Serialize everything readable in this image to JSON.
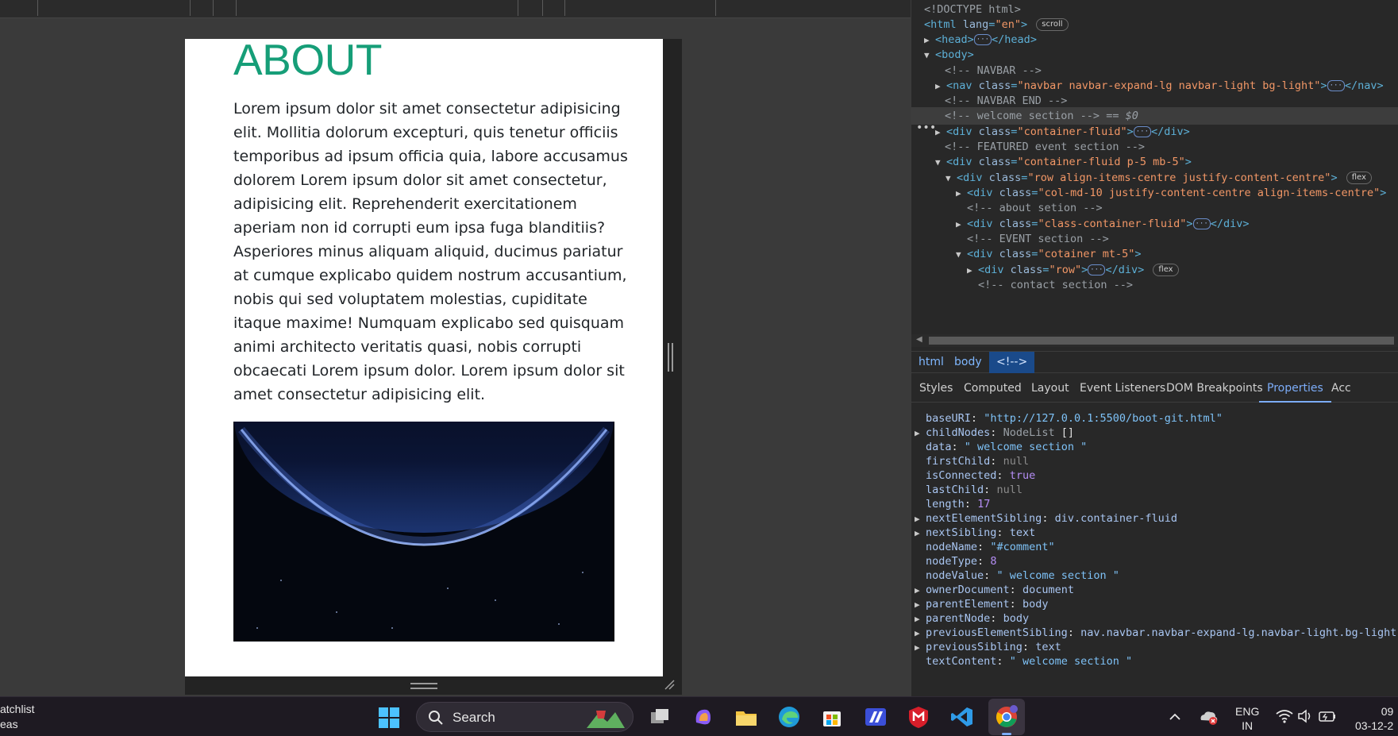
{
  "viewport": {
    "about_heading": "ABOUT",
    "about_paragraph": "Lorem ipsum dolor sit amet consectetur adipisicing elit. Mollitia dolorum excepturi, quis tenetur officiis temporibus ad ipsum officia quia, labore accusamus dolorem Lorem ipsum dolor sit amet consectetur, adipisicing elit. Reprehenderit exercitationem aperiam non id corrupti eum ipsa fuga blanditiis? Asperiores minus aliquam aliquid, ducimus pariatur at cumque explicabo quidem nostrum accusantium, nobis qui sed voluptatem molestias, cupiditate itaque maxime! Numquam explicabo sed quisquam animi architecto veritatis quasi, nobis corrupti obcaecati Lorem ipsum dolor. Lorem ipsum dolor sit amet consectetur adipisicing elit.",
    "image_icon": "earth-from-space-image"
  },
  "devtools": {
    "dom": {
      "doctype": "<!DOCTYPE html>",
      "html_open": "<html",
      "lang_attr": "lang",
      "lang_val": "\"en\"",
      "html_close_bracket": ">",
      "scroll_badge": "scroll",
      "head_open": "<head>",
      "head_close": "</head>",
      "body_open": "<body>",
      "cmt_navbar": "<!-- NAVBAR -->",
      "nav_open": "<nav",
      "nav_class": "\"navbar navbar-expand-lg navbar-light bg-light\"",
      "nav_close": "</nav>",
      "cmt_navbar_end": "<!-- NAVBAR END -->",
      "cmt_welcome": "<!-- welcome section -->",
      "selected_marker": "== $0",
      "div_open": "<div",
      "class_attr": "class",
      "div_close": "</div>",
      "cls_container_fluid": "\"container-fluid\"",
      "cmt_featured": "<!--  FEATURED event section -->",
      "cls_container_p5": "\"container-fluid p-5 mb-5\"",
      "cls_row": "\"row align-items-centre justify-content-centre\"",
      "flex_badge": "flex",
      "cls_col": "\"col-md-10 justify-content-centre align-items-centre\"",
      "cmt_about": "<!-- about setion -->",
      "cls_class_container": "\"class-container-fluid\"",
      "cmt_event": "<!-- EVENT section -->",
      "cls_cotainer": "\"cotainer mt-5\"",
      "cls_row2": "\"row\"",
      "cmt_contact": "<!-- contact section -->",
      "ellipsis": "···",
      "eq": "="
    },
    "breadcrumbs": [
      "html",
      "body",
      "<!-->"
    ],
    "tabs": [
      "Styles",
      "Computed",
      "Layout",
      "Event Listeners",
      "DOM Breakpoints",
      "Properties",
      "Acc"
    ],
    "active_tab": "Properties",
    "properties": {
      "baseURI_key": "baseURI",
      "baseURI_val": "\"http://127.0.0.1:5500/boot-git.html\"",
      "childNodes_key": "childNodes",
      "childNodes_val": "NodeList",
      "childNodes_brackets": "[]",
      "data_key": "data",
      "data_val": "\" welcome section \"",
      "firstChild_key": "firstChild",
      "null_val": "null",
      "isConnected_key": "isConnected",
      "true_val": "true",
      "lastChild_key": "lastChild",
      "length_key": "length",
      "length_val": "17",
      "nextElementSibling_key": "nextElementSibling",
      "nextElementSibling_val": "div.container-fluid",
      "nextSibling_key": "nextSibling",
      "text_val": "text",
      "nodeName_key": "nodeName",
      "nodeName_val": "\"#comment\"",
      "nodeType_key": "nodeType",
      "nodeType_val": "8",
      "nodeValue_key": "nodeValue",
      "nodeValue_val": "\" welcome section \"",
      "ownerDocument_key": "ownerDocument",
      "ownerDocument_val": "document",
      "parentElement_key": "parentElement",
      "body_val": "body",
      "parentNode_key": "parentNode",
      "previousElementSibling_key": "previousElementSibling",
      "previousElementSibling_val": "nav.navbar.navbar-expand-lg.navbar-light.bg-light",
      "previousSibling_key": "previousSibling",
      "textContent_key": "textContent",
      "textContent_val": "\" welcome section \"",
      "colon": ":"
    }
  },
  "taskbar": {
    "left_app_line1": "atchlist",
    "left_app_line2": "eas",
    "search_label": "Search",
    "ime_line1": "ENG",
    "ime_line2": "IN",
    "time": "09",
    "date": "03-12-2",
    "icons": [
      "windows-start-icon",
      "search-icon",
      "task-view-icon",
      "copilot-icon",
      "file-explorer-icon",
      "edge-icon",
      "store-icon",
      "vscode-alt-icon",
      "mcafee-icon",
      "vscode-icon",
      "chrome-icon",
      "chevron-up-icon",
      "onedrive-icon",
      "wifi-icon",
      "volume-icon",
      "battery-icon"
    ]
  },
  "colors": {
    "about_heading": "#169e78",
    "devtools_bg": "#282828",
    "active_tab": "#7cacf8",
    "crumb_active_bg": "#1a4a8a"
  }
}
